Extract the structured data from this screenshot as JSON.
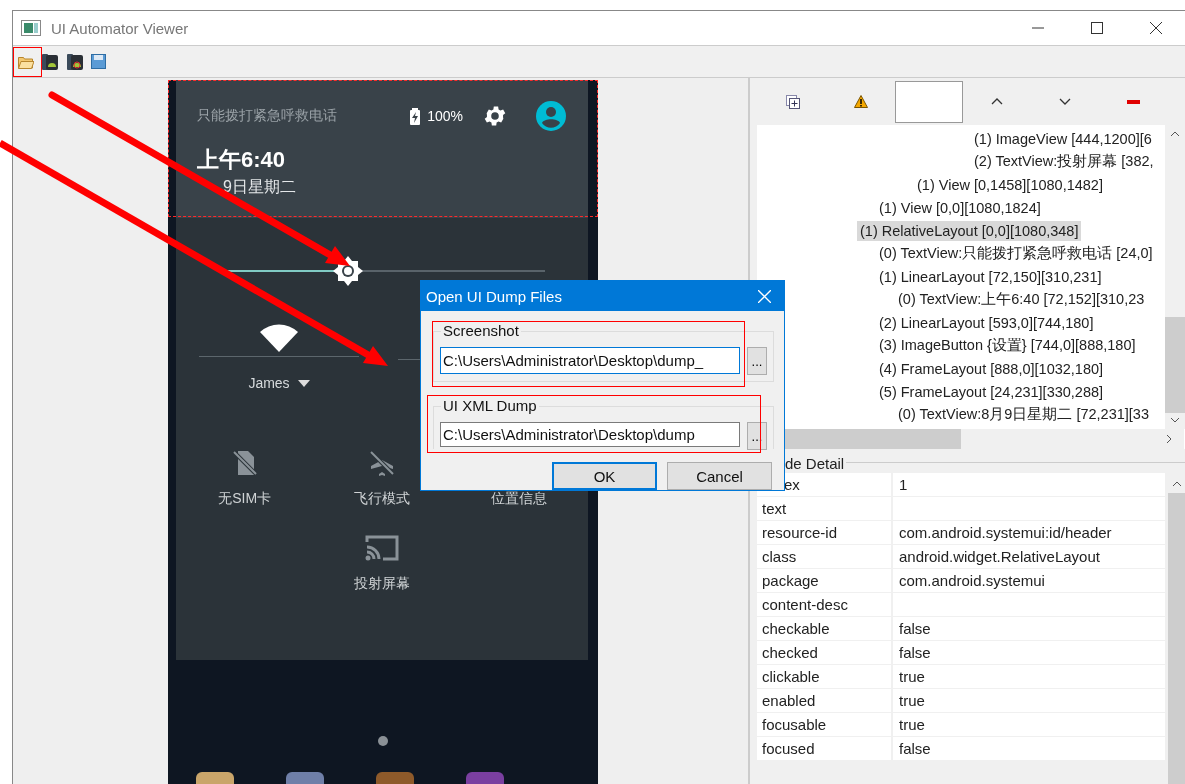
{
  "window": {
    "title": "UI Automator Viewer"
  },
  "phone": {
    "header": {
      "notice": "只能拨打紧急呼救电话",
      "battery": "100%",
      "time": "上午6:40",
      "date": "9日星期二"
    },
    "brightness": {
      "level": 0.375
    },
    "network": {
      "label": "James"
    },
    "tiles": [
      {
        "kind": "no-sim",
        "label": "无SIM卡"
      },
      {
        "kind": "airplane",
        "label": "飞行模式"
      },
      {
        "kind": "location",
        "label": "位置信息"
      },
      {
        "kind": "cast",
        "label": "投射屏幕"
      }
    ]
  },
  "tree": [
    {
      "children": [
        {
          "children": [
            {
              "children": [
                {
                  "children": [
                    {
                      "children": [
                        {
                          "children": [
                            {
                              "label": "(1) ImageView [444,1200][6",
                              "selected": false
                            },
                            {
                              "label": "(2) TextView:投射屏幕 [382,",
                              "selected": false
                            }
                          ]
                        }
                      ]
                    }
                  ]
                },
                {
                  "label": "(1) View [0,1458][1080,1482]",
                  "selected": false
                }
              ]
            }
          ]
        },
        {
          "label": "(1) View [0,0][1080,1824]",
          "selected": false
        }
      ]
    },
    {
      "label": "(1) RelativeLayout [0,0][1080,348]",
      "selected": true,
      "children": [
        {
          "label": "(0) TextView:只能拨打紧急呼救电话 [24,0]",
          "selected": false
        },
        {
          "label": "(1) LinearLayout [72,150][310,231]",
          "selected": false,
          "children": [
            {
              "label": "(0) TextView:上午6:40 [72,152][310,23",
              "selected": false
            }
          ]
        },
        {
          "label": "(2) LinearLayout [593,0][744,180]",
          "selected": false
        },
        {
          "label": "(3) ImageButton {设置} [744,0][888,180]",
          "selected": false
        },
        {
          "label": "(4) FrameLayout [888,0][1032,180]",
          "selected": false
        },
        {
          "label": "(5) FrameLayout [24,231][330,288]",
          "selected": false,
          "children": [
            {
              "label": "(0) TextView:8月9日星期二 [72,231][33",
              "selected": false
            }
          ]
        }
      ]
    }
  ],
  "node_detail": {
    "title": "de Detail",
    "rows": [
      {
        "key": "ex",
        "value": "1"
      },
      {
        "key": "text"
      },
      {
        "key": "resource-id",
        "value": "com.android.systemui:id/header"
      },
      {
        "key": "class",
        "value": "android.widget.RelativeLayout"
      },
      {
        "key": "package",
        "value": "com.android.systemui"
      },
      {
        "key": "content-desc"
      },
      {
        "key": "checkable",
        "value": "false"
      },
      {
        "key": "checked",
        "value": "false"
      },
      {
        "key": "clickable",
        "value": "true"
      },
      {
        "key": "enabled",
        "value": "true"
      },
      {
        "key": "focusable",
        "value": "true"
      },
      {
        "key": "focused",
        "value": "false"
      }
    ]
  },
  "dialog": {
    "title": "Open UI Dump Files",
    "groups": [
      {
        "label": "Screenshot",
        "value": "C:\\Users\\Administrator\\Desktop\\dump_",
        "focused": true,
        "browse": "..."
      },
      {
        "label": "UI XML Dump",
        "value": "C:\\Users\\Administrator\\Desktop\\dump",
        "focused": false,
        "browse": "..."
      }
    ],
    "buttons": [
      {
        "label": "OK",
        "default": true
      },
      {
        "label": "Cancel",
        "default": false
      }
    ]
  }
}
